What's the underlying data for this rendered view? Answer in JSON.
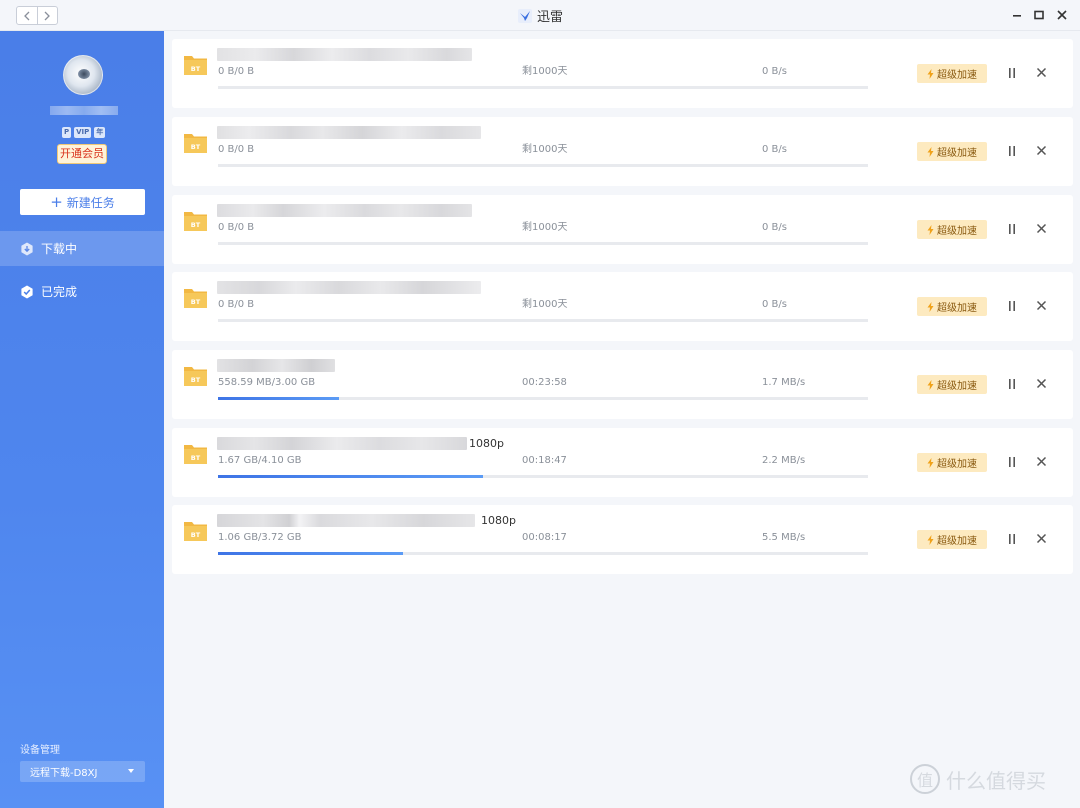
{
  "window": {
    "title": "迅雷"
  },
  "sidebar": {
    "badges": [
      "P",
      "VIP",
      "年"
    ],
    "vip_button": "开通会员",
    "new_task": "新建任务",
    "nav": [
      {
        "label": "下载中",
        "active": true
      },
      {
        "label": "已完成",
        "active": false
      }
    ],
    "device_section": "设备管理",
    "device_value": "远程下载-D8XJ"
  },
  "tasks": [
    {
      "name_suffix": "",
      "size": "0 B/0 B",
      "remaining": "剩1000天",
      "speed": "0 B/s",
      "progress": 0
    },
    {
      "name_suffix": "",
      "size": "0 B/0 B",
      "remaining": "剩1000天",
      "speed": "0 B/s",
      "progress": 0
    },
    {
      "name_suffix": "",
      "size": "0 B/0 B",
      "remaining": "剩1000天",
      "speed": "0 B/s",
      "progress": 0
    },
    {
      "name_suffix": "",
      "size": "0 B/0 B",
      "remaining": "剩1000天",
      "speed": "0 B/s",
      "progress": 0
    },
    {
      "name_suffix": "",
      "size": "558.59 MB/3.00 GB",
      "remaining": "00:23:58",
      "speed": "1.7 MB/s",
      "progress": 0.186
    },
    {
      "name_suffix": "1080p",
      "size": "1.67 GB/4.10 GB",
      "remaining": "00:18:47",
      "speed": "2.2 MB/s",
      "progress": 0.408
    },
    {
      "name_suffix": "1080p",
      "size": "1.06 GB/3.72 GB",
      "remaining": "00:08:17",
      "speed": "5.5 MB/s",
      "progress": 0.285
    }
  ],
  "task_actions": {
    "accelerate": "超级加速"
  },
  "watermark": {
    "logo": "值",
    "text": "什么值得买"
  },
  "colors": {
    "sidebar": "#4a7ee8",
    "progress": "#3e74e6",
    "accelerate_bg": "#fdeac0",
    "background": "#f4f6fa"
  }
}
